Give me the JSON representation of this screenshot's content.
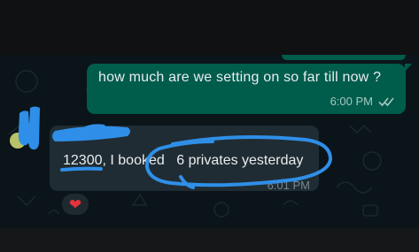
{
  "conversation": {
    "outgoing": {
      "text": "how much are we setting on so far till now ?",
      "time": "6:00 PM",
      "status_icon": "double-check-read-icon"
    },
    "incoming": {
      "amount": "12300",
      "text_middle": ", I booked ",
      "highlight": "6 privates yesterday",
      "time": "6:01 PM",
      "reaction": "❤",
      "reaction_icon": "heart-icon"
    }
  },
  "colors": {
    "outgoing_bubble": "#005c4b",
    "incoming_bubble": "#202c33",
    "chat_background": "#0b1418",
    "annotation_blue": "#2f8fe8"
  }
}
